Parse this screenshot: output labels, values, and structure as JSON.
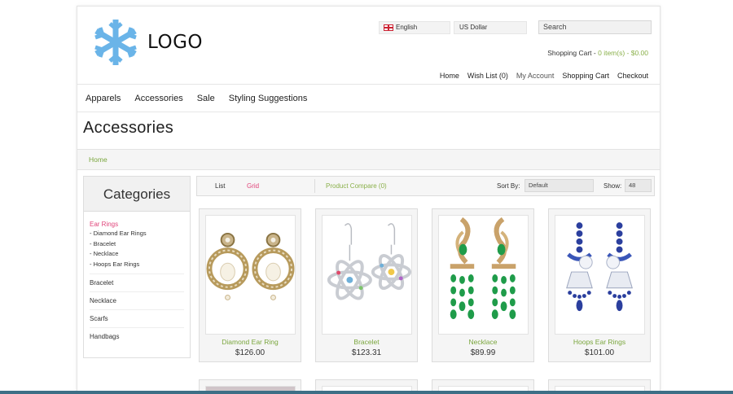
{
  "header": {
    "logo_text": "LOGO",
    "language": "English",
    "currency": "US Dollar",
    "search_placeholder": "Search",
    "cart_label": "Shopping Cart - ",
    "cart_value": "0 item(s) - $0.00",
    "top_links": [
      "Home",
      "Wish List (0)",
      "My Account",
      "Shopping Cart",
      "Checkout"
    ]
  },
  "nav": [
    "Apparels",
    "Accessories",
    "Sale",
    "Styling Suggestions"
  ],
  "page_title": "Accessories",
  "breadcrumb": "Home",
  "sidebar": {
    "title": "Categories",
    "active": "Ear Rings",
    "sub_items": [
      "- Diamond Ear Rings",
      "- Bracelet",
      "- Necklace",
      "- Hoops Ear Rings"
    ],
    "items": [
      "Bracelet",
      "Necklace",
      "Scarfs",
      "Handbags"
    ]
  },
  "toolbar": {
    "list": "List",
    "grid": "Grid",
    "compare": "Product Compare (0)",
    "sort_label": "Sort By:",
    "sort_value": "Default",
    "show_label": "Show:",
    "show_value": "48"
  },
  "products": [
    {
      "name": "Diamond Ear Ring",
      "price": "$126.00",
      "icon": "pearl-earrings-image"
    },
    {
      "name": "Bracelet",
      "price": "$123.31",
      "icon": "atom-earrings-image"
    },
    {
      "name": "Necklace",
      "price": "$89.99",
      "icon": "emerald-earrings-image"
    },
    {
      "name": "Hoops Ear Rings",
      "price": "$101.00",
      "icon": "sapphire-earrings-image"
    }
  ],
  "colors": {
    "accent_green": "#8ab04a",
    "accent_pink": "#e0447a",
    "logo_blue": "#6ab4e8"
  }
}
